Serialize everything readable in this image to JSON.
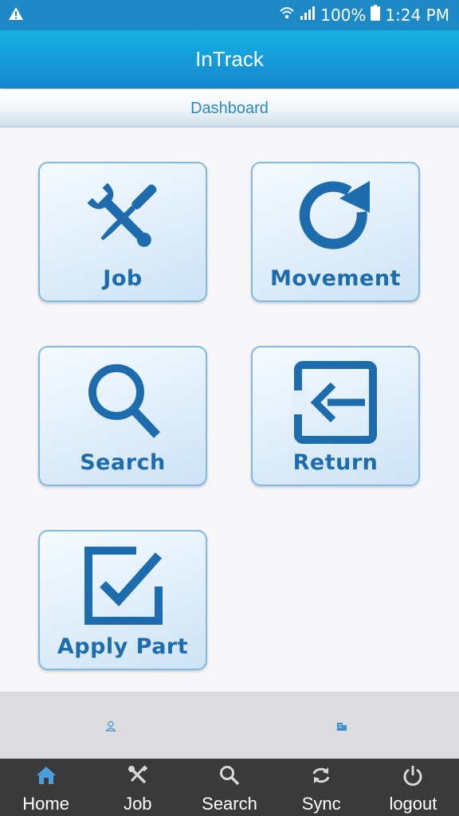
{
  "status_bar": {
    "battery": "100%",
    "time": "1:24 PM",
    "icons": [
      "warning-icon",
      "wifi-icon",
      "signal-icon",
      "battery-icon"
    ]
  },
  "app": {
    "title": "InTrack"
  },
  "page": {
    "subtitle": "Dashboard"
  },
  "tiles": [
    {
      "label": "Job",
      "icon": "wrench-screwdriver-icon"
    },
    {
      "label": "Movement",
      "icon": "refresh-arrow-icon"
    },
    {
      "label": "Search",
      "icon": "magnifier-icon"
    },
    {
      "label": "Return",
      "icon": "return-arrow-icon"
    },
    {
      "label": "Apply Part",
      "icon": "checkbox-icon"
    }
  ],
  "footer_icons": [
    "user-icon",
    "building-icon"
  ],
  "nav": [
    {
      "label": "Home",
      "icon": "home-icon",
      "active": true
    },
    {
      "label": "Job",
      "icon": "tools-icon"
    },
    {
      "label": "Search",
      "icon": "search-icon"
    },
    {
      "label": "Sync",
      "icon": "sync-icon"
    },
    {
      "label": "logout",
      "icon": "power-icon"
    }
  ],
  "colors": {
    "accent": "#1d8ac7",
    "tile_text": "#1d6cae",
    "nav_bg": "#3a3a3a",
    "nav_active": "#4a9fe0"
  }
}
